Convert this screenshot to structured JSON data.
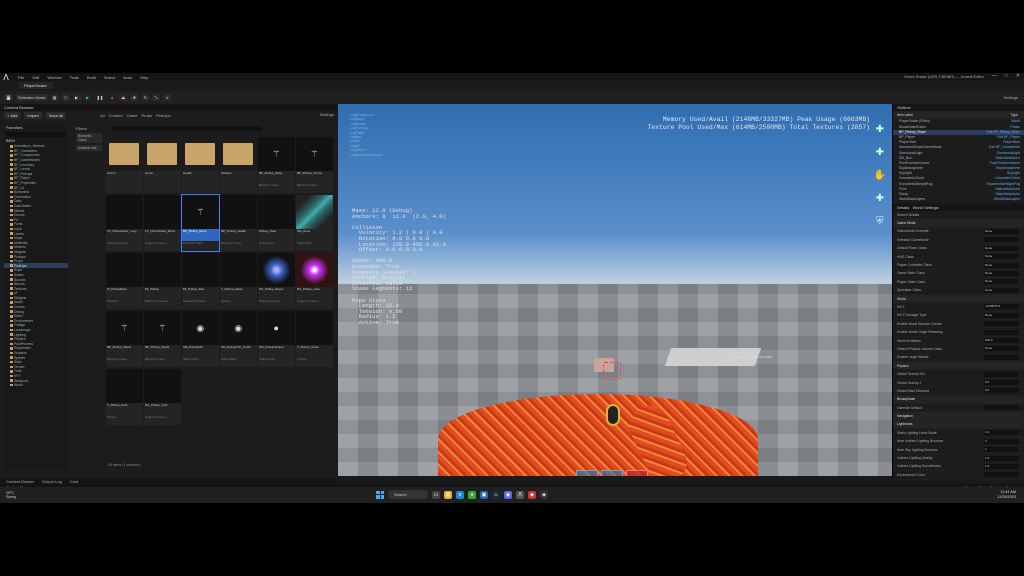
{
  "app": {
    "title": "Mona Snake (UE5.3 BEMH) — Unreal Editor",
    "project_tab": "PlayerSnake",
    "menu": [
      "File",
      "Edit",
      "Window",
      "Tools",
      "Build",
      "Select",
      "Actor",
      "Help"
    ],
    "window_controls": [
      "—",
      "□",
      "✕"
    ]
  },
  "toolbar": {
    "mode_label": "Selection Mode",
    "settings_label": "Settings",
    "buttons": [
      "Save",
      "Add",
      "Platforms"
    ]
  },
  "content_browser": {
    "tab_label": "Content Browser",
    "add_label": "+ Add",
    "import_label": "Import",
    "save_all_label": "Save All",
    "breadcrumbs": [
      "All",
      "Content",
      "Game",
      "Props",
      "PickUps"
    ],
    "settings_label": "Settings",
    "favorites_label": "Favorites",
    "tree_header": "BEM",
    "filters_label": "Filters",
    "filter_chips": [
      "Blueprint Class",
      "Material Inst"
    ],
    "search_placeholder": "Search PickUps",
    "tree_items": [
      "Animations_Meshes",
      "BP_Characters",
      "BP_Components",
      "BP_GameModes",
      "BP_Inventory",
      "BP_Levels",
      "BP_Pickups",
      "BP_Player",
      "BP_Projectiles",
      "BP_UI",
      "Blueprints",
      "Cinematics",
      "Data",
      "DataTables",
      "Effects",
      "Enums",
      "FX",
      "Fonts",
      "Input",
      "Levels",
      "Maps",
      "Materials",
      "Meshes",
      "Niagara",
      "Pickups",
      "Props",
      "PickUps",
      "Rope",
      "Snake",
      "Sounds",
      "Structs",
      "Textures",
      "UI",
      "Widgets",
      "Audio",
      "Curves",
      "Debug",
      "Editor",
      "Environment",
      "Foliage",
      "Landscape",
      "Lighting",
      "Physics",
      "PostProcess",
      "Sequences",
      "Shaders",
      "Splines",
      "Stats",
      "Terrain",
      "Tools",
      "VFX",
      "Weapons",
      "World"
    ],
    "assets": [
      {
        "name": "Ammo",
        "type": "",
        "kind": "folder"
      },
      {
        "name": "Armor",
        "type": "",
        "kind": "folder"
      },
      {
        "name": "Health",
        "type": "",
        "kind": "folder"
      },
      {
        "name": "Pickups",
        "type": "",
        "kind": "folder"
      },
      {
        "name": "BP_Pickup_Base",
        "type": "Blueprint Class",
        "kind": "wand"
      },
      {
        "name": "BP_Pickup_Ammo",
        "type": "Blueprint Class",
        "kind": "wand"
      },
      {
        "name": "FX_PickupGlow_Loop",
        "type": "Niagara System",
        "kind": "dark"
      },
      {
        "name": "FX_PickupGlow_Burst",
        "type": "Niagara System",
        "kind": "dark"
      },
      {
        "name": "BP_Pickup_Rope",
        "type": "Blueprint Class",
        "kind": "wand",
        "selected": true
      },
      {
        "name": "BP_Pickup_Health",
        "type": "Blueprint Class",
        "kind": "dark"
      },
      {
        "name": "Pickup_Data",
        "type": "Data Asset",
        "kind": "dark"
      },
      {
        "name": "SM_Rope",
        "type": "Static Mesh",
        "kind": "rope"
      },
      {
        "name": "M_PickupBase",
        "type": "Material",
        "kind": "dark"
      },
      {
        "name": "MI_Pickup",
        "type": "Material Instance",
        "kind": "dark"
      },
      {
        "name": "MI_Pickup_Red",
        "type": "Material Instance",
        "kind": "dark"
      },
      {
        "name": "T_Pickup_Mask",
        "type": "Texture",
        "kind": "dark"
      },
      {
        "name": "NS_Pickup_Beam",
        "type": "Niagara System",
        "kind": "blue"
      },
      {
        "name": "NS_Pickup_Glow",
        "type": "Niagara System",
        "kind": "purple"
      },
      {
        "name": "BP_Pickup_Wand",
        "type": "Blueprint Class",
        "kind": "wand"
      },
      {
        "name": "BP_Pickup_Spark",
        "type": "Blueprint Class",
        "kind": "wand"
      },
      {
        "name": "SM_PickupOrb",
        "type": "Static Mesh",
        "kind": "orb"
      },
      {
        "name": "SM_PickupOrb_Small",
        "type": "Static Mesh",
        "kind": "orb"
      },
      {
        "name": "SM_PickupSphere",
        "type": "Static Mesh",
        "kind": "sphere"
      },
      {
        "name": "T_Pickup_Noise",
        "type": "Texture",
        "kind": "dark"
      },
      {
        "name": "T_Pickup_Dark",
        "type": "Texture",
        "kind": "dark"
      },
      {
        "name": "NS_Pickup_Trail",
        "type": "Niagara System",
        "kind": "dark"
      }
    ],
    "item_count": "26 items (1 selected)",
    "bottom_tabs": [
      "Content Drawer",
      "Output Log",
      "Cmd"
    ]
  },
  "viewport": {
    "stats": [
      "Memory Used/Avail (2148MB/33327MB) Peak Usage (6663MB)",
      "Texture Pool Used/Max (614MB/2500MB) Total Textures (2857)"
    ],
    "top_left_debug": [
      "LogBlueprint",
      "LogRope",
      "LogSnake",
      "LogPickup",
      "LogTemp",
      "LogNet",
      "LogAI",
      "LogUI",
      "LogInput",
      "LogEnhancedInput"
    ],
    "debug_block": "Mass: 12.0 (Debug)\nAnchors: 8  12.0  (2.0, 4.0)\n\nCollision\n  Velocity: 1.2 | 0.8 | 0.0\n  Rotation: 0.0 0.0 0.0\n  Location: 120.0 450.0 92.0\n  Offset: 0.0 0.0 0.0\n\nSpeed: 400.0\nGrounded: True\nSegments Spawned: 1\nEnabled: Gravity\nDetached: False\nSnake Segments: 12\n\nRope State\n  Length: 12.0\n  Tension: 0.50\n  Radius: 1.5\n  Active: True",
    "overlay_message": "Press E to pick up rope",
    "right_labels": [
      "—",
      "—",
      "—",
      "—",
      "—",
      "—",
      "—",
      "—"
    ]
  },
  "outliner": {
    "title": "Outliner",
    "search_placeholder": "Search...",
    "col_label": "Item Label",
    "col_type": "Type",
    "rows": [
      {
        "label": "PlayerSnake (Editor)",
        "type": "World",
        "sel": false
      },
      {
        "label": "MonaSnakeEditor",
        "type": "Folder",
        "sel": false
      },
      {
        "label": "BP_Pickup_Rope",
        "type": "Edit BP_Pickup_Rope",
        "sel": true
      },
      {
        "label": "BP_Player",
        "type": "Edit BP_Player",
        "sel": false
      },
      {
        "label": "PlayerStart",
        "type": "PlayerStart",
        "sel": false
      },
      {
        "label": "AdvancedSnakeGameMode",
        "type": "Edit BP_GameMode",
        "sel": false
      },
      {
        "label": "DirectionalLight",
        "type": "DirectionalLight",
        "sel": false
      },
      {
        "label": "SM_Box",
        "type": "StaticMeshActor",
        "sel": false
      },
      {
        "label": "PostProcessVolume",
        "type": "PostProcessVolume",
        "sel": false
      },
      {
        "label": "SkyAtmosphere",
        "type": "SkyAtmosphere",
        "sel": false
      },
      {
        "label": "SkyLight",
        "type": "SkyLight",
        "sel": false
      },
      {
        "label": "VolumetricCloud",
        "type": "VolumetricCloud",
        "sel": false
      },
      {
        "label": "ExponentialHeightFog",
        "type": "ExponentialHeightFog",
        "sel": false
      },
      {
        "label": "Floor",
        "type": "StaticMeshActor",
        "sel": false
      },
      {
        "label": "Ramp",
        "type": "StaticMeshActor",
        "sel": false
      },
      {
        "label": "WorldDataLayers",
        "type": "WorldDataLayers",
        "sel": false
      }
    ],
    "actor_count": "16 actors"
  },
  "details": {
    "title": "Details",
    "tab2": "World Settings",
    "search_placeholder": "Search Details",
    "rows": [
      {
        "label": "Game Mode",
        "value": "",
        "hdr": true
      },
      {
        "label": "GameMode Override",
        "value": "None"
      },
      {
        "label": "Selected GameMode",
        "value": ""
      },
      {
        "label": "Default Pawn Class",
        "value": "None"
      },
      {
        "label": "HUD Class",
        "value": "None"
      },
      {
        "label": "Player Controller Class",
        "value": "None"
      },
      {
        "label": "Game State Class",
        "value": "None"
      },
      {
        "label": "Player State Class",
        "value": "None"
      },
      {
        "label": "Spectator Class",
        "value": "None"
      },
      {
        "label": "World",
        "value": "",
        "hdr": true
      },
      {
        "label": "Kill Z",
        "value": "-1048575.0"
      },
      {
        "label": "Kill Z Damage Type",
        "value": "None"
      },
      {
        "label": "Enable World Bounds Checks",
        "value": ""
      },
      {
        "label": "Enable World Origin Rebasing",
        "value": ""
      },
      {
        "label": "World to Meters",
        "value": "100.0"
      },
      {
        "label": "Default Physics Volume Class",
        "value": "None"
      },
      {
        "label": "Enable Large Worlds",
        "value": ""
      },
      {
        "label": "Physics",
        "value": "",
        "hdr": true
      },
      {
        "label": "Global Gravity Set",
        "value": ""
      },
      {
        "label": "Global Gravity Z",
        "value": "0.0"
      },
      {
        "label": "Default Max Distance",
        "value": "0.0"
      },
      {
        "label": "Broadphase",
        "value": "",
        "hdr": true
      },
      {
        "label": "Override Default",
        "value": ""
      },
      {
        "label": "Navigation",
        "value": "",
        "hdr": true
      },
      {
        "label": "Lightmass",
        "value": "",
        "hdr": true
      },
      {
        "label": "Static Lighting Level Scale",
        "value": "1.0"
      },
      {
        "label": "Num Indirect Lighting Bounces",
        "value": "3"
      },
      {
        "label": "Num Sky Lighting Bounces",
        "value": "1"
      },
      {
        "label": "Indirect Lighting Quality",
        "value": "1.0"
      },
      {
        "label": "Indirect Lighting Smoothness",
        "value": "1.0"
      },
      {
        "label": "Environment Color",
        "value": ""
      }
    ]
  },
  "status": {
    "left": "Content Drawer",
    "right": "Derived Data  |  Revision Control"
  },
  "taskbar": {
    "weather_temp": "19°C",
    "weather_desc": "Sunny",
    "search_label": "Search",
    "time": "11:44 AM",
    "date": "11/25/2023"
  }
}
